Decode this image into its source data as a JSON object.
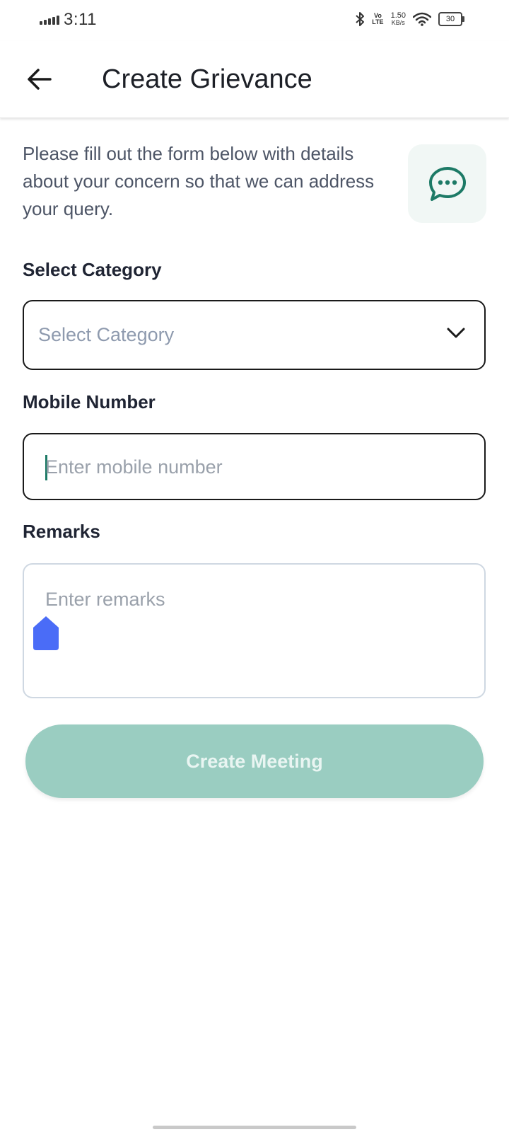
{
  "status_bar": {
    "time": "3:11",
    "network_tag_top": "Vo",
    "network_tag_bottom": "LTE",
    "speed_value": "1.50",
    "speed_unit": "KB/s",
    "battery_level": "30",
    "icons": [
      "signal-icon",
      "bluetooth-icon",
      "volte-icon",
      "wifi-icon",
      "battery-icon"
    ]
  },
  "header": {
    "back_icon": "arrow-left-icon",
    "title": "Create Grievance"
  },
  "intro": {
    "text": "Please fill out the form below with details about your concern so that we can address your query.",
    "icon": "chat-bubble-icon"
  },
  "form": {
    "category": {
      "label": "Select Category",
      "placeholder": "Select Category",
      "icon": "chevron-down-icon"
    },
    "mobile": {
      "label": "Mobile Number",
      "placeholder": "Enter mobile number",
      "value": ""
    },
    "remarks": {
      "label": "Remarks",
      "placeholder": "Enter remarks",
      "value": ""
    },
    "submit_label": "Create Meeting"
  },
  "colors": {
    "accent": "#1d7a66",
    "button_disabled": "#9acdc1",
    "selection_handle": "#4a6cf7",
    "text_primary": "#1f2433",
    "text_secondary": "#4d5566",
    "placeholder": "#9aa1ab"
  }
}
